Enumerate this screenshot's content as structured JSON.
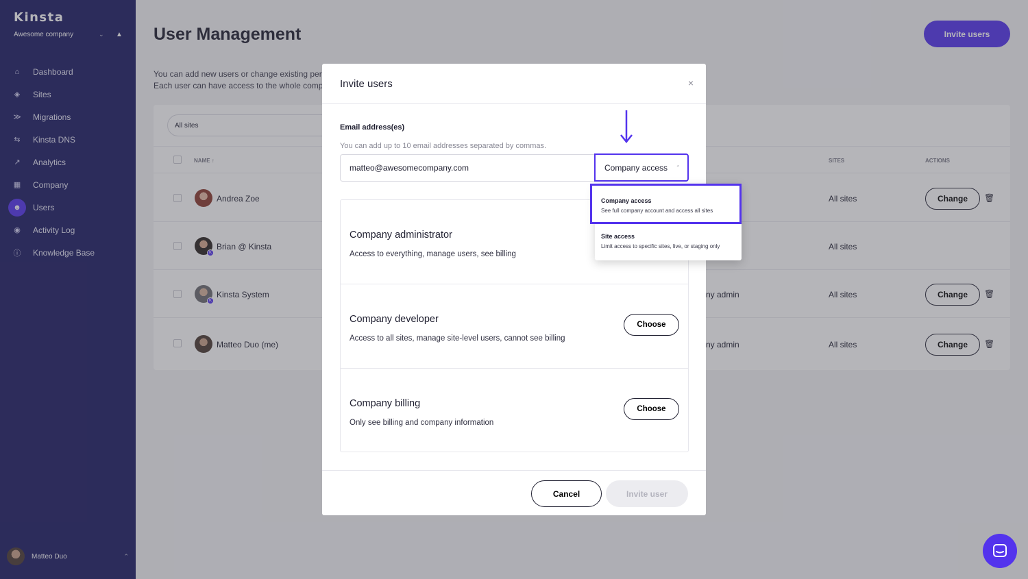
{
  "sidebar": {
    "logo": "Kinsta",
    "company": "Awesome company",
    "items": [
      {
        "label": "Dashboard",
        "icon": "home-icon"
      },
      {
        "label": "Sites",
        "icon": "layers-icon"
      },
      {
        "label": "Migrations",
        "icon": "arrow-right-icon"
      },
      {
        "label": "Kinsta DNS",
        "icon": "dns-icon"
      },
      {
        "label": "Analytics",
        "icon": "trend-icon"
      },
      {
        "label": "Company",
        "icon": "building-icon"
      },
      {
        "label": "Users",
        "icon": "user-plus-icon",
        "active": true
      },
      {
        "label": "Activity Log",
        "icon": "eye-icon"
      },
      {
        "label": "Knowledge Base",
        "icon": "help-icon"
      }
    ],
    "user": "Matteo Duo"
  },
  "page": {
    "title": "User Management",
    "invite_button": "Invite users",
    "intro_line1": "You can add new users or change existing perm",
    "intro_line2": "Each user can have access to the whole compar"
  },
  "table": {
    "filter": "All sites",
    "headers": {
      "name": "NAME ↑",
      "sites": "SITES",
      "actions": "ACTIONS"
    },
    "rows": [
      {
        "name": "Andrea Zoe",
        "role": "",
        "sites": "All sites",
        "action": "Change",
        "trash": true
      },
      {
        "name": "Brian @ Kinsta",
        "role": "",
        "sites": "All sites",
        "action": "",
        "trash": false
      },
      {
        "name": "Kinsta System",
        "role": "ny admin",
        "sites": "All sites",
        "action": "Change",
        "trash": true
      },
      {
        "name": "Matteo Duo (me)",
        "role": "ny admin",
        "sites": "All sites",
        "action": "Change",
        "trash": true
      }
    ]
  },
  "modal": {
    "title": "Invite users",
    "close": "×",
    "email_label": "Email address(es)",
    "email_help": "You can add up to 10 email addresses separated by commas.",
    "email_value": "matteo@awesomecompany.com",
    "access_selected": "Company access",
    "roles": [
      {
        "name": "Company administrator",
        "desc": "Access to everything, manage users, see billing",
        "button": ""
      },
      {
        "name": "Company developer",
        "desc": "Access to all sites, manage site-level users, cannot see billing",
        "button": "Choose"
      },
      {
        "name": "Company billing",
        "desc": "Only see billing and company information",
        "button": "Choose"
      }
    ],
    "cancel": "Cancel",
    "invite": "Invite user"
  },
  "dropdown": {
    "options": [
      {
        "title": "Company access",
        "desc": "See full company account and access all sites",
        "selected": true
      },
      {
        "title": "Site access",
        "desc": "Limit access to specific sites, live, or staging only",
        "selected": false
      }
    ]
  },
  "colors": {
    "accent": "#5333ed",
    "sidebar": "#1c1b63"
  }
}
